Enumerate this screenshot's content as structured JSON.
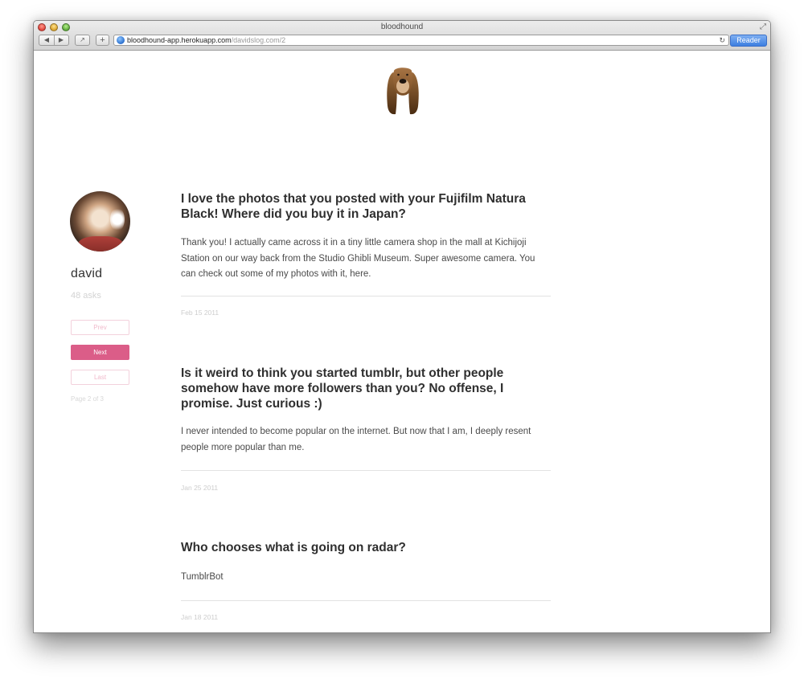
{
  "browser": {
    "title": "bloodhound",
    "url_host": "bloodhound-app.herokuapp.com",
    "url_path": "/davidslog.com/2",
    "reader_label": "Reader",
    "back_glyph": "◀",
    "forward_glyph": "▶",
    "plus_glyph": "+",
    "share_glyph": "↗",
    "reload_glyph": "↻",
    "fullscreen_glyph": "⤢"
  },
  "colors": {
    "accent": "#db5d88",
    "logo_brown": "#8a5a2e"
  },
  "profile": {
    "name": "david",
    "asks": "48 asks"
  },
  "pagination": {
    "prev": "Prev",
    "next": "Next",
    "last": "Last",
    "info": "Page 2 of 3"
  },
  "posts": [
    {
      "question": "I love the photos that you posted with your Fujifilm Natura Black! Where did you buy it in Japan?",
      "answer": "Thank you! I actually came across it in a tiny little camera shop in the mall at Kichijoji Station on our way back from the Studio Ghibli Museum. Super awesome camera. You can check out some of my photos with it, here.",
      "date": "Feb 15 2011"
    },
    {
      "question": "Is it weird to think you started tumblr, but other people somehow have more followers than you? No offense, I promise. Just curious :)",
      "answer": "I never intended to become popular on the internet. But now that I am, I deeply resent people more popular than me.",
      "date": "Jan 25 2011"
    },
    {
      "question": "Who chooses what is going on radar?",
      "answer": "TumblrBot",
      "date": "Jan 18 2011"
    }
  ]
}
